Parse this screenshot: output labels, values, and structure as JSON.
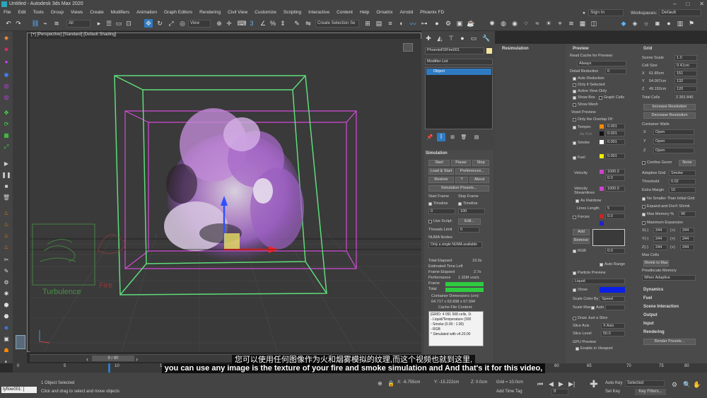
{
  "window": {
    "title": "Untitled - Autodesk 3ds Max 2020"
  },
  "menu": [
    "File",
    "Edit",
    "Tools",
    "Group",
    "Views",
    "Create",
    "Modifiers",
    "Animation",
    "Graph Editors",
    "Rendering",
    "Civil View",
    "Customize",
    "Scripting",
    "Interactive",
    "Content",
    "Help",
    "Ornatrix",
    "Arnold",
    "Phoenix FD"
  ],
  "account": {
    "sign_in": "Sign In",
    "workspaces_label": "Workspaces:",
    "workspace": "Default"
  },
  "toolbar": {
    "filter": "All",
    "view": "View",
    "selection_set": "Create Selection Se"
  },
  "viewport": {
    "label": "[+] [Perspective] [Standard] [Default Shading]",
    "text_turbulence": "Turbulence",
    "text_fire": "Fire"
  },
  "cmd": {
    "object_name": "PhoenixFDFire001",
    "modifier_list": "Modifier List",
    "stack_item": "Object",
    "simulation_title": "Simulation",
    "start": "Start",
    "pause": "Pause",
    "stop": "Stop",
    "load_start": "Load & Start",
    "preferences": "Preferences...",
    "restore": "Restore",
    "help": "?",
    "about": "About",
    "sim_presets": "Simulation Presets...",
    "start_frame": "Start Frame",
    "stop_frame": "Stop Frame",
    "timeline1": "Timeline",
    "timeline2": "Timeline",
    "start_val": "0",
    "stop_val": "100",
    "use_script": "Use Script:",
    "edit": "Edit...",
    "threads_limit": "Threads Limit",
    "threads_val": "0",
    "numa": "NUMA Nodes:",
    "numa_placeholder": "Only a single NUMA available",
    "total_elapsed": "Total Elapsed",
    "total_elapsed_val": "19.9s",
    "est_time": "Estimated Time Left",
    "frame_elapsed": "Frame Elapsed",
    "frame_elapsed_val": "2.7s",
    "performance": "Performance",
    "performance_val": "1.32M vox/s",
    "frame": "Frame",
    "total": "Total",
    "frame_progress": 1.0,
    "total_progress": 1.0,
    "container_dims": "Container Dimensions (cm):",
    "container_dims_val": "64.717 x 63.898 x 67.994",
    "cache_content": "Cache File Content:",
    "cache_lines": [
      "[GRID: 4 091 568 cells, 1t",
      "- Liquid/Temperature (300",
      "- Smoke (0.00 : 1.00)",
      "- RGB",
      "* Simulated with v4.20.00"
    ]
  },
  "resim": {
    "title": "Resimulation"
  },
  "preview": {
    "title": "Preview",
    "read_cache": "Read Cache for Preview:",
    "read_cache_val": "Always",
    "detail_reduction": "Detail Reduction",
    "detail_val": "0",
    "auto_reduction": "Auto Reduction",
    "only_selected": "Only if Selected",
    "active_view_only": "Active View Only",
    "show_box": "Show Box",
    "graph_cells": "Graph Cells",
    "show_mesh": "Show Mesh",
    "voxel_preview": "Voxel Preview",
    "only_overlap": "Only the Overlap Of:",
    "temper": "Temper.",
    "as_fire": "As Fire",
    "smoke": "Smoke",
    "fuel": "Fuel",
    "velocity": "Velocity",
    "velocity_streamlines": "Velocity Streamlines",
    "as_rainbow": "As Rainbow",
    "lines_length": "Lines Length",
    "lines_val": "5",
    "forces": "Forces",
    "add": "Add",
    "remove": "Remove",
    "rgb": "RGB",
    "auto_range": "Auto Range",
    "v1": "0.001",
    "v2": "0.001",
    "v3": "0.001",
    "v4": "1000.0",
    "v5": "0.0",
    "v6": "1000.0",
    "v7": "0.0",
    "v8": "0.0",
    "v9": "0.001",
    "particle_preview": "Particle Preview",
    "particle_val": "Liquid",
    "show": "Show",
    "scale_color_by": "Scale Color By",
    "scale_color_val": "Speed",
    "scale_max": "Scale Max",
    "auto": "Auto",
    "draw_slice": "Draw Just a Slice",
    "slice_axis": "Slice Axis",
    "slice_axis_val": "X Axis",
    "slice_level": "Slice Level",
    "slice_level_val": "50.0",
    "gpu_preview": "GPU Preview",
    "enable_viewport": "Enable in Viewport"
  },
  "grid": {
    "title": "Grid",
    "scene_scale": "Scene Scale",
    "scene_scale_val": "1.0",
    "cell_size": "Cell Size",
    "cell_size_val": "0.41cm",
    "x": "X",
    "x_size": "61.85cm",
    "x_cells": "151",
    "y": "Y",
    "y_size": "54.067cm",
    "y_cells": "132",
    "z": "Z",
    "z_size": "49.152cm",
    "z_cells": "120",
    "total_cells": "Total Cells",
    "total_cells_val": "2 391 840",
    "increase_res": "Increase Resolution",
    "decrease_res": "Decrease Resolution",
    "container_walls": "Container Walls",
    "wall_x": "Open",
    "wall_y": "Open",
    "wall_z": "Open",
    "confine_geom": "Confine Geom",
    "confine_val": "None",
    "adaptive_grid": "Adaptive Grid",
    "adaptive_val": "Smoke",
    "threshold": "Threshold",
    "threshold_val": "0.02",
    "extra_margin": "Extra Margin",
    "extra_margin_val": "10",
    "no_smaller": "No Smaller Than Initial Grid",
    "expand_dont_shrink": "Expand and Don't Shrink",
    "max_memory": "Max Memory %",
    "max_memory_val": "90",
    "max_expansion": "Maximum Expansion",
    "ex": "X(-)",
    "ey": "Y(-)",
    "ez": "Z(-)",
    "ex_p": "(+)",
    "ey_p": "(+)",
    "ez_p": "(+)",
    "exp_val": "244",
    "max_cells": "Max Cells",
    "shrink_to_max": "Shrink to Max",
    "preallocate": "Preallocate Memory",
    "preallocate_val": "When Adaptive",
    "dynamics": "Dynamics",
    "fuel": "Fuel",
    "scene_interaction": "Scene Interaction",
    "output": "Output",
    "input": "Input",
    "rendering": "Rendering",
    "render_presets": "Render Presets..."
  },
  "timeline": {
    "frame_counter": "9 / 80",
    "ticks": [
      "0",
      "5",
      "10",
      "15",
      "55",
      "60",
      "65",
      "70",
      "75",
      "80"
    ]
  },
  "status": {
    "maxscript": "tyflow001: [",
    "selected": "1 Object Selected",
    "hint": "Click and drag to select and move objects",
    "x": "X: -6.755cm",
    "y": "Y: -15.222cm",
    "z": "Z: 0.0cm",
    "grid": "Grid = 10.0cm",
    "add_time_tag": "Add Time Tag",
    "auto_key": "Auto Key",
    "set_key": "Set Key",
    "selected_dd": "Selected",
    "key_filters": "Key Filters...",
    "frame_field": "9"
  },
  "subtitles": {
    "zh": "您可以使用任何图像作为火和烟雾模拟的纹理,而这个视频也就到这里,",
    "en": "you can use any image is the texture of your fire and smoke simulation and And that's it for this video,"
  },
  "colors": {
    "accent": "#2f7bc3",
    "progress": "#2ecc40",
    "box_green": "#5fdc7a",
    "box_magenta": "#d24bd6",
    "smoke_purple": "#b07bd0"
  }
}
